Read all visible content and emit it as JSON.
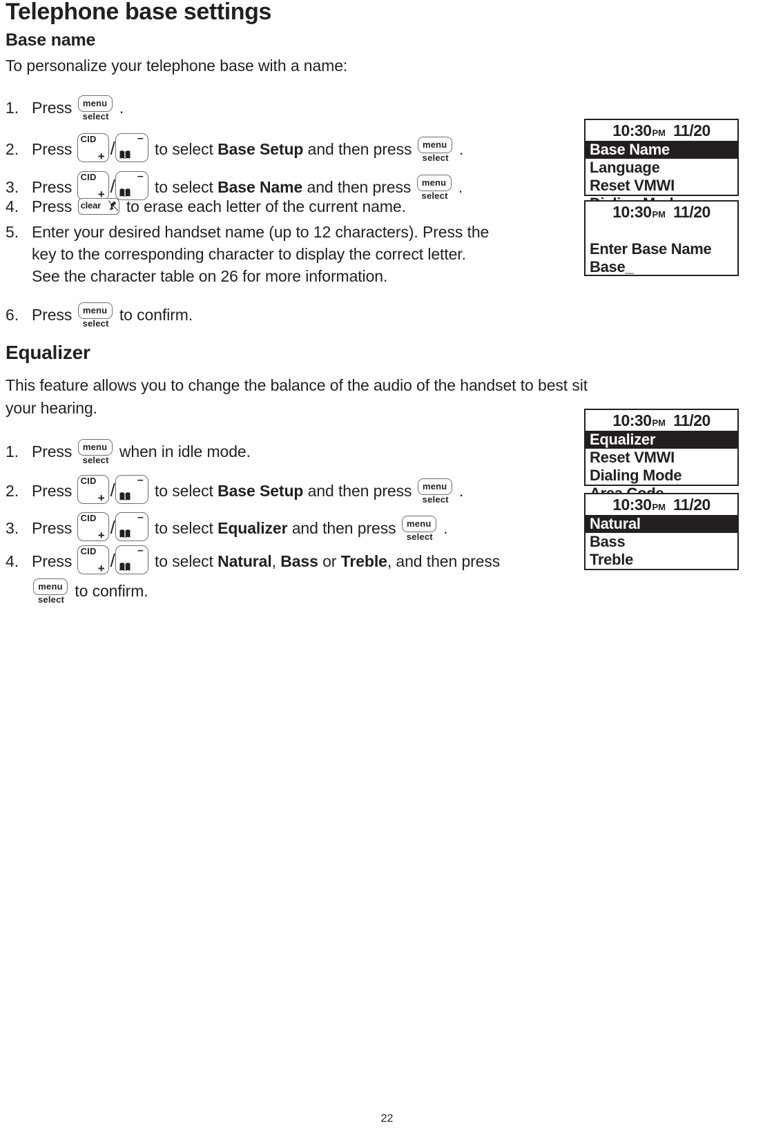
{
  "document": {
    "title": "Telephone base settings",
    "page_number": "22"
  },
  "keys": {
    "menu_top": "menu",
    "menu_bottom": "select",
    "cid_label": "CID",
    "cid_plus": "+",
    "down_minus": "–",
    "down_icon": "phonebook-book-icon",
    "clear_label": "clear",
    "clear_icon": "mute-microphone-icon",
    "slash": "/"
  },
  "sections": [
    {
      "heading": "Base name",
      "intro": "To personalize your telephone base with a name:",
      "steps": [
        {
          "num": "1.",
          "pre": "Press",
          "post": "."
        },
        {
          "num": "2.",
          "pre": "Press",
          "mid": "to select",
          "target": "Base Setup",
          "mid2": "and then press",
          "post": "."
        },
        {
          "num": "3.",
          "pre": "Press",
          "mid": "to select",
          "target": "Base Name",
          "mid2": "and then press",
          "post": "."
        },
        {
          "num": "4.",
          "pre": "Press",
          "post": "to erase each letter of the current name."
        },
        {
          "num": "5.",
          "lines": [
            "Enter your desired handset name (up to 12 characters). Press the",
            "key to the corresponding character to display the correct letter.",
            "See the character table on 26 for more information."
          ]
        },
        {
          "num": "6.",
          "pre": "Press",
          "post": "to confirm."
        }
      ]
    },
    {
      "heading": "Equalizer",
      "intro_lines": [
        "This feature allows you to change the balance of the audio of the handset to best sit",
        "your hearing."
      ],
      "steps": [
        {
          "num": "1.",
          "pre": "Press",
          "post": "when in idle mode."
        },
        {
          "num": "2.",
          "pre": "Press",
          "mid": "to select",
          "target": "Base Setup",
          "mid2": "and then press",
          "post": "."
        },
        {
          "num": "3.",
          "pre": "Press",
          "mid": "to select",
          "target": "Equalizer",
          "mid2": "and then press",
          "post": "."
        },
        {
          "num": "4.",
          "pre": "Press",
          "mid": "to select",
          "targets": [
            "Natural",
            "Bass",
            "Treble"
          ],
          "sep1": ",",
          "sep2": "or",
          "sep3": ",",
          "mid2": "and then press",
          "post": "to confirm."
        }
      ]
    }
  ],
  "lcd_screens": [
    {
      "id": "base-setup-menu",
      "time": "10:30",
      "ampm": "PM",
      "date": "11/20",
      "rows": [
        {
          "text": "Base Name",
          "selected": true
        },
        {
          "text": "Language",
          "selected": false
        },
        {
          "text": "Reset VMWI",
          "selected": false
        },
        {
          "text": "Dialing Mode",
          "selected": false
        }
      ]
    },
    {
      "id": "enter-base-name",
      "time": "10:30",
      "ampm": "PM",
      "date": "11/20",
      "rows": [
        {
          "text": "",
          "selected": false,
          "blank": true
        },
        {
          "text": "Enter Base Name",
          "selected": false
        },
        {
          "text": "Base_",
          "selected": false
        }
      ]
    },
    {
      "id": "equalizer-menu",
      "time": "10:30",
      "ampm": "PM",
      "date": "11/20",
      "rows": [
        {
          "text": "Equalizer",
          "selected": true
        },
        {
          "text": "Reset VMWI",
          "selected": false
        },
        {
          "text": "Dialing Mode",
          "selected": false
        },
        {
          "text": "Area Code",
          "selected": false
        }
      ]
    },
    {
      "id": "equalizer-options",
      "time": "10:30",
      "ampm": "PM",
      "date": "11/20",
      "rows": [
        {
          "text": "Natural",
          "selected": true
        },
        {
          "text": "Bass",
          "selected": false
        },
        {
          "text": "Treble",
          "selected": false
        }
      ]
    }
  ],
  "colors": {
    "ink": "#231f20",
    "key_outline": "#6d6e71",
    "lcd_highlight": "#231f20",
    "page_bg": "#ffffff"
  }
}
